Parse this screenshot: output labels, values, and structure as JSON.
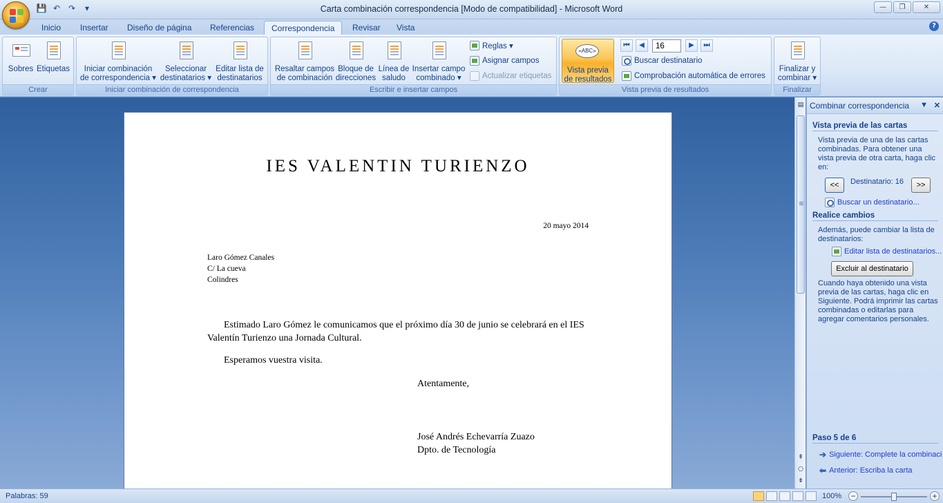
{
  "window": {
    "title": "Carta combinación correspondencia [Modo de compatibilidad] - Microsoft Word",
    "minimize": "—",
    "maximize": "❐",
    "close": "✕"
  },
  "qat": {
    "save": "💾",
    "undo": "↶",
    "redo": "↷",
    "customize": "▾"
  },
  "tabs": [
    {
      "label": "Inicio"
    },
    {
      "label": "Insertar"
    },
    {
      "label": "Diseño de página"
    },
    {
      "label": "Referencias"
    },
    {
      "label": "Correspondencia",
      "active": true
    },
    {
      "label": "Revisar"
    },
    {
      "label": "Vista"
    }
  ],
  "help": "?",
  "ribbon": {
    "crear": {
      "label": "Crear",
      "sobres": "Sobres",
      "etiquetas": "Etiquetas"
    },
    "iniciar": {
      "label": "Iniciar combinación de correspondencia",
      "iniciar_l1": "Iniciar combinación",
      "iniciar_l2": "de correspondencia ▾",
      "seleccionar_l1": "Seleccionar",
      "seleccionar_l2": "destinatarios ▾",
      "editar_l1": "Editar lista de",
      "editar_l2": "destinatarios"
    },
    "escribir": {
      "label": "Escribir e insertar campos",
      "resaltar_l1": "Resaltar campos",
      "resaltar_l2": "de combinación",
      "bloque_l1": "Bloque de",
      "bloque_l2": "direcciones",
      "linea_l1": "Línea de",
      "linea_l2": "saludo",
      "insertar_l1": "Insertar campo",
      "insertar_l2": "combinado ▾",
      "reglas": "Reglas ▾",
      "asignar": "Asignar campos",
      "actualizar": "Actualizar etiquetas"
    },
    "vista_previa": {
      "label": "Vista previa de resultados",
      "vista_l1": "Vista previa",
      "vista_l2": "de resultados",
      "vista_icon_text": "«ABC»",
      "record": "16",
      "first": "⏮",
      "prev": "◀",
      "next": "▶",
      "last": "⏭",
      "buscar": "Buscar destinatario",
      "comprobacion": "Comprobación automática de errores"
    },
    "finalizar": {
      "label": "Finalizar",
      "finalizar_l1": "Finalizar y",
      "finalizar_l2": "combinar ▾"
    }
  },
  "document": {
    "heading": "IES VALENTIN TURIENZO",
    "date": "20 mayo 2014",
    "address": [
      "Laro Gómez Canales",
      "C/ La cueva",
      "Colindres"
    ],
    "body1": "Estimado Laro Gómez le comunicamos que el próximo día 30 de junio se celebrará en el IES Valentín Turienzo una Jornada Cultural.",
    "body2": "Esperamos vuestra visita.",
    "closing": "Atentamente,",
    "signature": [
      "José Andrés Echevarría Zuazo",
      "Dpto. de Tecnología"
    ]
  },
  "taskpane": {
    "title": "Combinar correspondencia",
    "dropdown": "▼",
    "close": "✕",
    "section1": "Vista previa de las cartas",
    "intro": "Vista previa de una de las cartas combinadas. Para obtener una vista previa de otra carta, haga clic en:",
    "prev_btn": "<<",
    "next_btn": ">>",
    "destinatario": "Destinatario: 16",
    "buscar_link": "Buscar un destinatario...",
    "section2": "Realice cambios",
    "cambios_text": "Además, puede cambiar la lista de destinatarios:",
    "editar_link": "Editar lista de destinatarios...",
    "excluir_btn": "Excluir al destinatario",
    "after_text": "Cuando haya obtenido una vista previa de las cartas, haga clic en Siguiente. Podrá imprimir las cartas combinadas o editarlas para agregar comentarios personales.",
    "step": "Paso 5 de 6",
    "siguiente": "Siguiente: Complete la combinación",
    "anterior": "Anterior: Escriba la carta"
  },
  "status": {
    "words": "Palabras: 59",
    "zoom": "100%",
    "zoom_minus": "−",
    "zoom_plus": "+",
    "zoom_level": 0.5
  },
  "colors": {
    "office_logo": [
      "#e8462f",
      "#7cbf3f",
      "#2f7bd6",
      "#f5c02a"
    ]
  }
}
